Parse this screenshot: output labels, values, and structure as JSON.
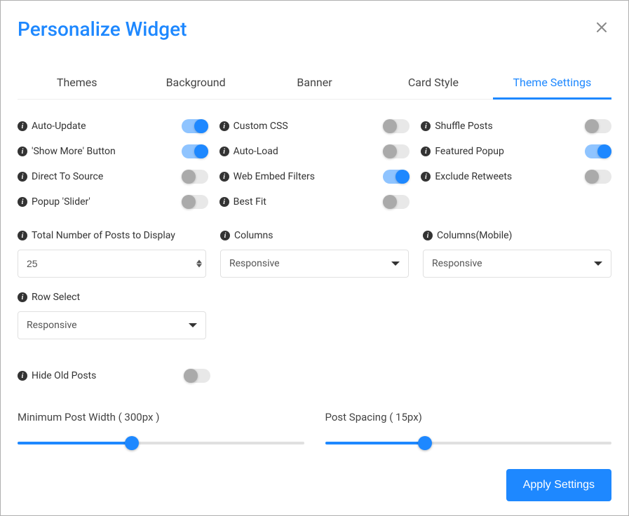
{
  "header": {
    "title": "Personalize Widget"
  },
  "tabs": {
    "themes": "Themes",
    "background": "Background",
    "banner": "Banner",
    "card_style": "Card Style",
    "theme_settings": "Theme Settings"
  },
  "toggles": {
    "auto_update": {
      "label": "Auto-Update",
      "on": true
    },
    "custom_css": {
      "label": "Custom CSS",
      "on": false
    },
    "shuffle_posts": {
      "label": "Shuffle Posts",
      "on": false
    },
    "show_more": {
      "label": "'Show More' Button",
      "on": true
    },
    "auto_load": {
      "label": "Auto-Load",
      "on": false
    },
    "featured_popup": {
      "label": "Featured Popup",
      "on": true
    },
    "direct_source": {
      "label": "Direct To Source",
      "on": false
    },
    "web_embed": {
      "label": "Web Embed Filters",
      "on": true
    },
    "exclude_retweets": {
      "label": "Exclude Retweets",
      "on": false
    },
    "popup_slider": {
      "label": "Popup 'Slider'",
      "on": false
    },
    "best_fit": {
      "label": "Best Fit",
      "on": false
    },
    "hide_old": {
      "label": "Hide Old Posts",
      "on": false
    }
  },
  "fields": {
    "total_posts": {
      "label": "Total Number of Posts to Display",
      "value": "25"
    },
    "columns": {
      "label": "Columns",
      "value": "Responsive"
    },
    "columns_mobile": {
      "label": "Columns(Mobile)",
      "value": "Responsive"
    },
    "row_select": {
      "label": "Row Select",
      "value": "Responsive"
    }
  },
  "sliders": {
    "min_width": {
      "label": "Minimum Post Width ( 300px )",
      "percent": 40
    },
    "spacing": {
      "label": "Post Spacing ( 15px)",
      "percent": 35
    }
  },
  "footer": {
    "apply": "Apply Settings"
  }
}
